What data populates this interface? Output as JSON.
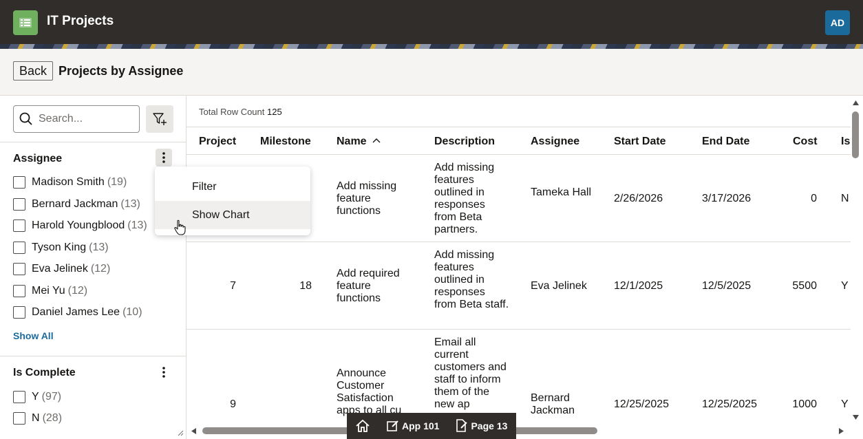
{
  "header": {
    "app_title": "IT Projects",
    "avatar_initials": "AD"
  },
  "titlebar": {
    "back_label": "Back",
    "page_title": "Projects by Assignee"
  },
  "search": {
    "placeholder": "Search..."
  },
  "facets": {
    "assignee": {
      "title": "Assignee",
      "items": [
        {
          "label": "Madison Smith",
          "count": "(19)"
        },
        {
          "label": "Bernard Jackman",
          "count": "(13)"
        },
        {
          "label": "Harold Youngblood",
          "count": "(13)"
        },
        {
          "label": "Tyson King",
          "count": "(13)"
        },
        {
          "label": "Eva Jelinek",
          "count": "(12)"
        },
        {
          "label": "Mei Yu",
          "count": "(12)"
        },
        {
          "label": "Daniel James Lee",
          "count": "(10)"
        }
      ],
      "show_all": "Show All"
    },
    "is_complete": {
      "title": "Is Complete",
      "items": [
        {
          "label": "Y",
          "count": "(97)"
        },
        {
          "label": "N",
          "count": "(28)"
        }
      ]
    }
  },
  "menu": {
    "items": [
      "Filter",
      "Show Chart"
    ]
  },
  "grid": {
    "row_count_label": "Total Row Count",
    "row_count": "125",
    "columns": [
      "Project",
      "Milestone",
      "Name",
      "Description",
      "Assignee",
      "Start Date",
      "End Date",
      "Cost",
      "Is"
    ],
    "rows": [
      {
        "project": "",
        "milestone": "",
        "name": "Add missing feature functions",
        "description": "Add missing features outlined in responses from Beta partners.",
        "assignee": "Tameka Hall",
        "start": "2/26/2026",
        "end": "3/17/2026",
        "cost": "0",
        "is": "N"
      },
      {
        "project": "7",
        "milestone": "18",
        "name": "Add required feature functions",
        "description": "Add missing features outlined in responses from Beta staff.",
        "assignee": "Eva Jelinek",
        "start": "12/1/2025",
        "end": "12/5/2025",
        "cost": "5500",
        "is": "Y"
      },
      {
        "project": "9",
        "milestone": "",
        "name": "Announce Customer Satisfaction apps to all cu",
        "description": "Email all current customers and staff to inform them of the new ap",
        "assignee": "Bernard Jackman",
        "start": "12/25/2025",
        "end": "12/25/2025",
        "cost": "1000",
        "is": "Y"
      }
    ]
  },
  "devbar": {
    "home_label": "",
    "app_label": "App 101",
    "page_label": "Page 13"
  },
  "colors": {
    "header_bg": "#312d2a",
    "logo_green": "#6fb05f",
    "avatar_blue": "#1b6a9c",
    "link_blue": "#1b6a9c"
  }
}
